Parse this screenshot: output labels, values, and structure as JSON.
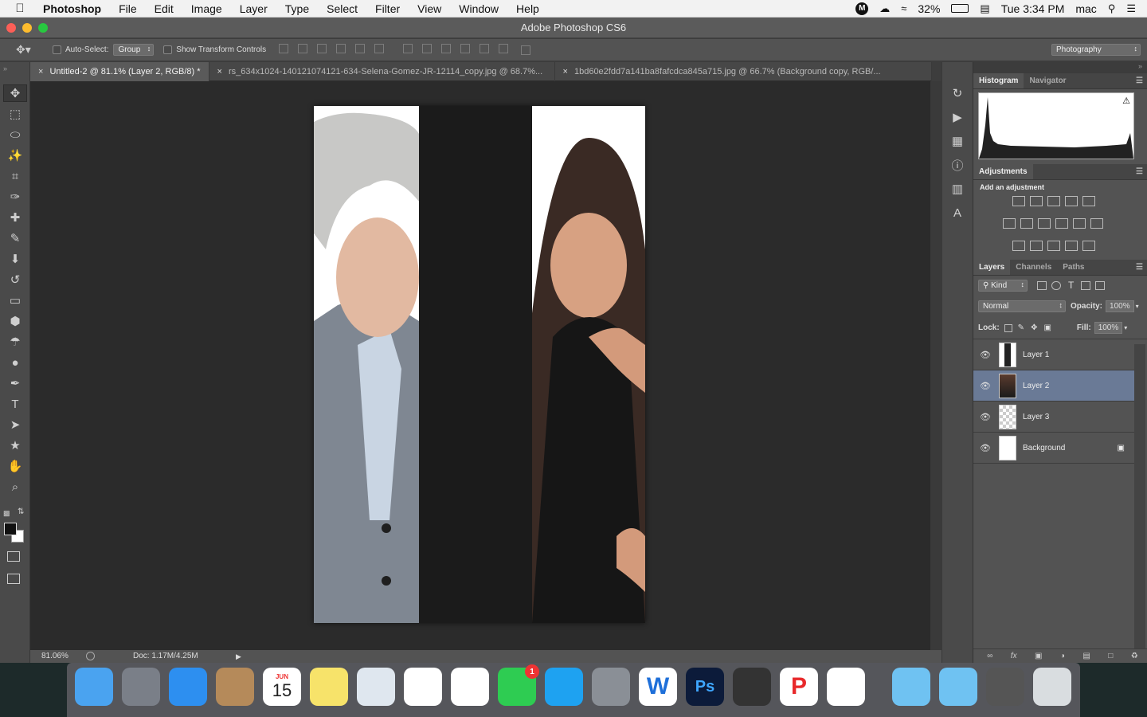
{
  "menubar": {
    "app_name": "Photoshop",
    "menus": [
      "File",
      "Edit",
      "Image",
      "Layer",
      "Type",
      "Select",
      "Filter",
      "View",
      "Window",
      "Help"
    ],
    "battery": "32%",
    "datetime": "Tue 3:34 PM",
    "user": "mac"
  },
  "window": {
    "title": "Adobe Photoshop CS6"
  },
  "options": {
    "auto_select_label": "Auto-Select:",
    "auto_select_value": "Group",
    "transform_label": "Show Transform Controls",
    "workspace": "Photography"
  },
  "tabs": [
    {
      "label": "Untitled-2 @ 81.1% (Layer 2, RGB/8) *",
      "active": true
    },
    {
      "label": "rs_634x1024-140121074121-634-Selena-Gomez-JR-12114_copy.jpg @ 68.7%...",
      "active": false
    },
    {
      "label": "1bd60e2fdd7a141ba8fafcdca845a715.jpg @ 66.7% (Background copy, RGB/...",
      "active": false
    }
  ],
  "tools": [
    "move-tool",
    "marquee-tool",
    "lasso-tool",
    "magic-wand-tool",
    "crop-tool",
    "eyedropper-tool",
    "healing-tool",
    "brush-tool",
    "stamp-tool",
    "history-brush-tool",
    "eraser-tool",
    "paint-bucket-tool",
    "blur-tool",
    "dodge-tool",
    "pen-tool",
    "type-tool",
    "path-select-tool",
    "shape-tool",
    "hand-tool",
    "zoom-tool"
  ],
  "status": {
    "zoom": "81.06%",
    "doc": "Doc: 1.17M/4.25M"
  },
  "panels": {
    "top_tabs": [
      "Histogram",
      "Navigator"
    ],
    "adjustments": {
      "tab": "Adjustments",
      "hint": "Add an adjustment"
    },
    "layer_tabs": [
      "Layers",
      "Channels",
      "Paths"
    ],
    "kind": "Kind",
    "blend": "Normal",
    "opacity_label": "Opacity:",
    "opacity": "100%",
    "lock_label": "Lock:",
    "fill_label": "Fill:",
    "fill": "100%",
    "layers": [
      {
        "name": "Layer 1",
        "selected": false
      },
      {
        "name": "Layer 2",
        "selected": true
      },
      {
        "name": "Layer 3",
        "selected": false
      },
      {
        "name": "Background",
        "selected": false
      }
    ]
  },
  "dock": {
    "calendar_month": "JUN",
    "calendar_day": "15",
    "facetime_badge": "1",
    "apps": [
      "finder",
      "launchpad",
      "safari",
      "contacts",
      "calendar",
      "notes",
      "preview",
      "photos",
      "reminders",
      "facetime",
      "app-store",
      "system-preferences",
      "word",
      "photoshop",
      "final-cut",
      "wps",
      "chrome",
      "folder",
      "folder",
      "photo-booth",
      "trash"
    ]
  }
}
